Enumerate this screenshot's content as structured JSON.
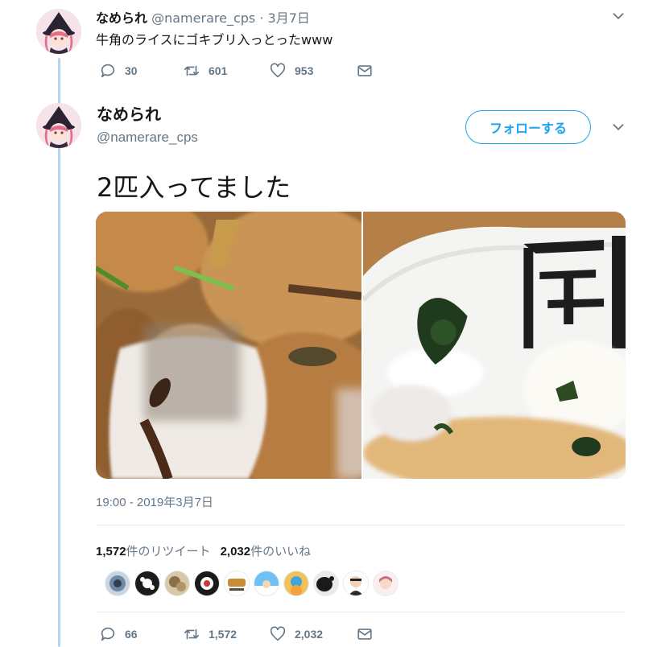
{
  "reply": {
    "display_name": "なめられ",
    "handle": "@namerare_cps",
    "separator": "·",
    "date": "3月7日",
    "text": "牛角のライスにゴキブリ入っとったwww",
    "actions": {
      "replies": "30",
      "retweets": "601",
      "likes": "953"
    },
    "caret_icon": "chevron-down-icon"
  },
  "main": {
    "display_name": "なめられ",
    "handle": "@namerare_cps",
    "follow_label": "フォローする",
    "text": "2匹入ってました",
    "timestamp": "19:00 - 2019年3月7日",
    "stats": {
      "retweet_count": "1,572",
      "retweet_label": "件のリツイート",
      "like_count": "2,032",
      "like_label": "件のいいね"
    },
    "actions": {
      "replies": "66",
      "retweets": "1,572",
      "likes": "2,032"
    },
    "caret_icon": "chevron-down-icon"
  },
  "liker_avatar_count": 10,
  "colors": {
    "accent": "#1da1f2",
    "secondary_text": "#657786",
    "thread_line": "#b3d7f1"
  }
}
